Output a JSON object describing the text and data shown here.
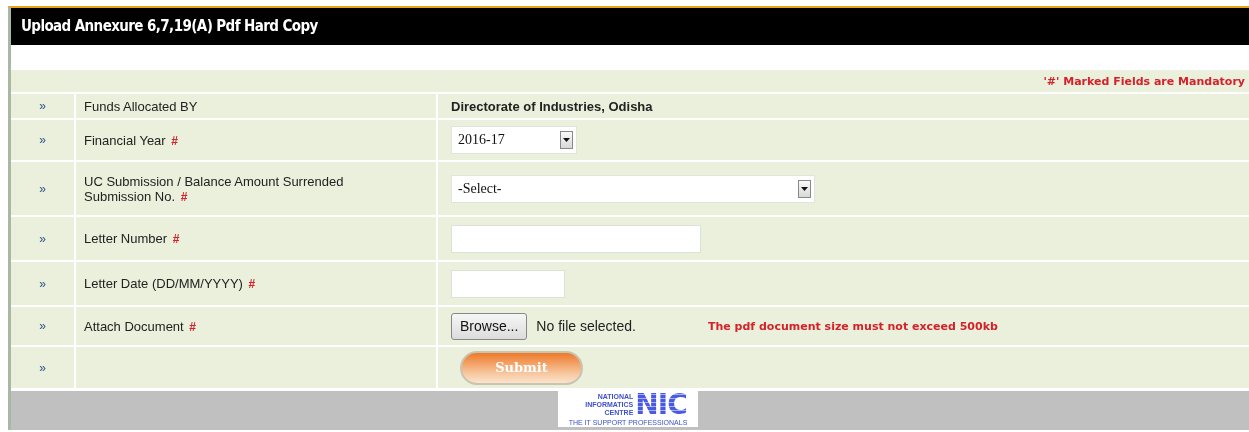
{
  "title": "Upload Annexure 6,7,19(A) Pdf Hard Copy",
  "mandatory_note": "'#' Marked Fields are Mandatory",
  "row_marker": "»",
  "rows": [
    {
      "kind": "text",
      "label": "Funds Allocated BY",
      "value": "Directorate of Industries, Odisha"
    },
    {
      "kind": "select",
      "label": "Financial Year",
      "required_mark": "#",
      "value": "2016-17",
      "wide": false
    },
    {
      "kind": "select",
      "label": "UC Submission / Balance Amount Surrended Submission No.",
      "required_mark": "#",
      "value": "-Select-",
      "wide": true
    },
    {
      "kind": "input",
      "label": "Letter Number",
      "required_mark": "#",
      "wide": true
    },
    {
      "kind": "input",
      "label": "Letter Date (DD/MM/YYYY)",
      "required_mark": "#",
      "wide": false
    },
    {
      "kind": "file",
      "label": "Attach Document",
      "required_mark": "#",
      "button": "Browse...",
      "status": "No file selected.",
      "note": "The pdf document size must not exceed 500kb"
    },
    {
      "kind": "submit",
      "button": "Submit"
    }
  ],
  "footer": {
    "logo_lines": [
      "NATIONAL",
      "INFORMATICS",
      "CENTRE"
    ],
    "logo_mark": "NIC",
    "logo_tagline": "THE IT SUPPORT PROFESSIONALS"
  }
}
